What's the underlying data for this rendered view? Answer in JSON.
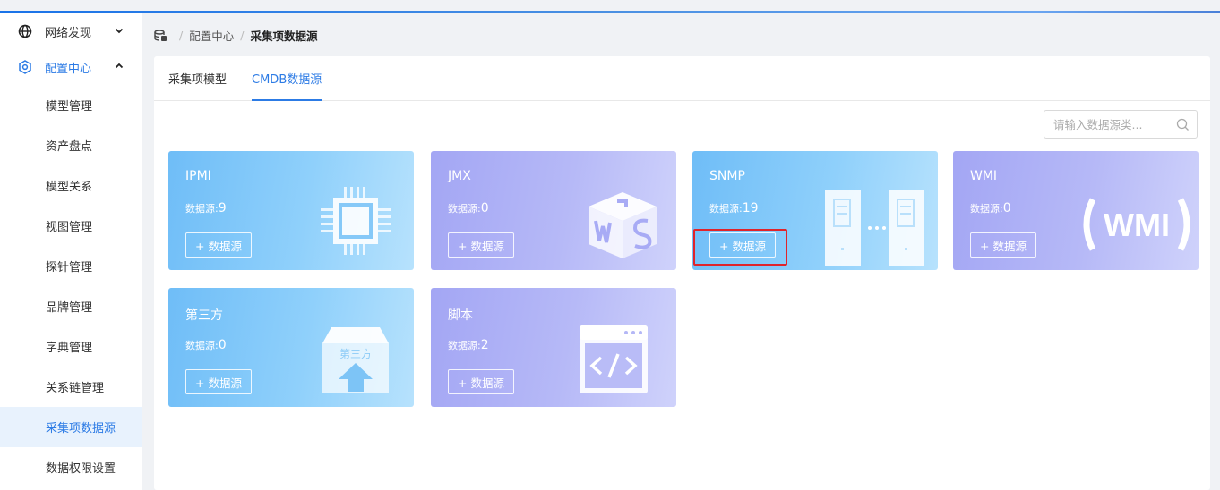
{
  "sidebar": {
    "groups": [
      {
        "label": "网络发现",
        "chevron": "⌄",
        "icon": "globe-icon"
      },
      {
        "label": "配置中心",
        "chevron": "⌃",
        "icon": "gear-icon"
      }
    ],
    "items": [
      "模型管理",
      "资产盘点",
      "模型关系",
      "视图管理",
      "探针管理",
      "品牌管理",
      "字典管理",
      "关系链管理",
      "采集项数据源",
      "数据权限设置"
    ],
    "selected_index": 8
  },
  "breadcrumb": {
    "root": "配置中心",
    "separator": "/",
    "current": "采集项数据源"
  },
  "tabs": [
    "采集项模型",
    "CMDB数据源"
  ],
  "active_tab": 1,
  "search": {
    "placeholder": "请输入数据源类..."
  },
  "cards": [
    {
      "title": "IPMI",
      "count_label": "数据源:",
      "count": "9",
      "button": "+ 数据源",
      "theme": "blue",
      "icon": "chip-icon"
    },
    {
      "title": "JMX",
      "count_label": "数据源:",
      "count": "0",
      "button": "+ 数据源",
      "theme": "purple",
      "icon": "jmx-cube-icon"
    },
    {
      "title": "SNMP",
      "count_label": "数据源:",
      "count": "19",
      "button": "+ 数据源",
      "theme": "blue",
      "icon": "servers-icon"
    },
    {
      "title": "WMI",
      "count_label": "数据源:",
      "count": "0",
      "button": "+ 数据源",
      "theme": "purple",
      "icon": "wmi-logo-icon",
      "icon_text": "WMI"
    },
    {
      "title": "第三方",
      "count_label": "数据源:",
      "count": "0",
      "button": "+ 数据源",
      "theme": "blue",
      "icon": "third-party-box-icon",
      "icon_text": "第三方"
    },
    {
      "title": "脚本",
      "count_label": "数据源:",
      "count": "2",
      "button": "+ 数据源",
      "theme": "purple",
      "icon": "code-window-icon"
    }
  ],
  "colors": {
    "accent": "#2c7be5",
    "highlight": "#e0242b",
    "selected_bg": "#e8f2fd"
  }
}
